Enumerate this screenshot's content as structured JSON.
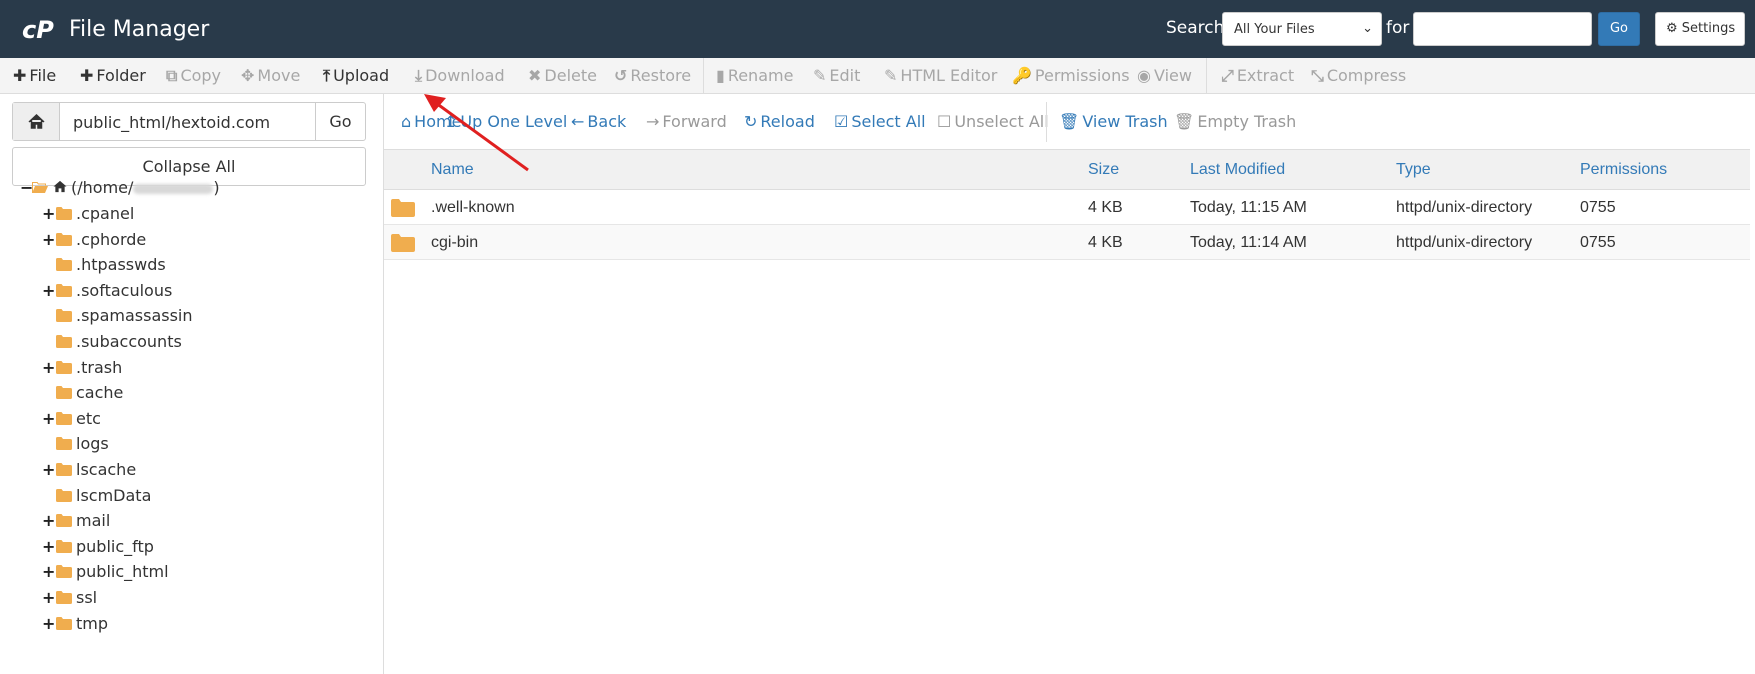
{
  "header": {
    "app_title": "File Manager",
    "search_label": "Search",
    "search_scope": "All Your Files",
    "for_label": "for",
    "search_value": "",
    "go_label": "Go",
    "settings_label": "Settings"
  },
  "toolbar": {
    "file": "File",
    "folder": "Folder",
    "copy": "Copy",
    "move": "Move",
    "upload": "Upload",
    "download": "Download",
    "delete": "Delete",
    "restore": "Restore",
    "rename": "Rename",
    "edit": "Edit",
    "html_editor": "HTML Editor",
    "permissions": "Permissions",
    "view": "View",
    "extract": "Extract",
    "compress": "Compress"
  },
  "sidebar": {
    "path_value": "public_html/hextoid.com",
    "go_label": "Go",
    "collapse_label": "Collapse All",
    "root_label_prefix": "(/home/",
    "root_label_suffix": ")",
    "items": [
      {
        "label": ".cpanel",
        "expandable": true
      },
      {
        "label": ".cphorde",
        "expandable": true
      },
      {
        "label": ".htpasswds",
        "expandable": false
      },
      {
        "label": ".softaculous",
        "expandable": true
      },
      {
        "label": ".spamassassin",
        "expandable": false
      },
      {
        "label": ".subaccounts",
        "expandable": false
      },
      {
        "label": ".trash",
        "expandable": true
      },
      {
        "label": "cache",
        "expandable": false
      },
      {
        "label": "etc",
        "expandable": true
      },
      {
        "label": "logs",
        "expandable": false
      },
      {
        "label": "lscache",
        "expandable": true
      },
      {
        "label": "lscmData",
        "expandable": false
      },
      {
        "label": "mail",
        "expandable": true
      },
      {
        "label": "public_ftp",
        "expandable": true
      },
      {
        "label": "public_html",
        "expandable": true
      },
      {
        "label": "ssl",
        "expandable": true
      },
      {
        "label": "tmp",
        "expandable": true
      }
    ]
  },
  "nav": {
    "home": "Home",
    "up_one_level": "Up One Level",
    "back": "Back",
    "forward": "Forward",
    "reload": "Reload",
    "select_all": "Select All",
    "unselect_all": "Unselect All",
    "view_trash": "View Trash",
    "empty_trash": "Empty Trash"
  },
  "table": {
    "columns": [
      "Name",
      "Size",
      "Last Modified",
      "Type",
      "Permissions"
    ],
    "rows": [
      {
        "name": ".well-known",
        "size": "4 KB",
        "modified": "Today, 11:15 AM",
        "type": "httpd/unix-directory",
        "perms": "0755"
      },
      {
        "name": "cgi-bin",
        "size": "4 KB",
        "modified": "Today, 11:14 AM",
        "type": "httpd/unix-directory",
        "perms": "0755"
      }
    ]
  },
  "colors": {
    "header_bg": "#293a4a",
    "link_blue": "#337ab7",
    "folder_orange": "#f0ad4e",
    "annotation_red": "#e02020"
  }
}
